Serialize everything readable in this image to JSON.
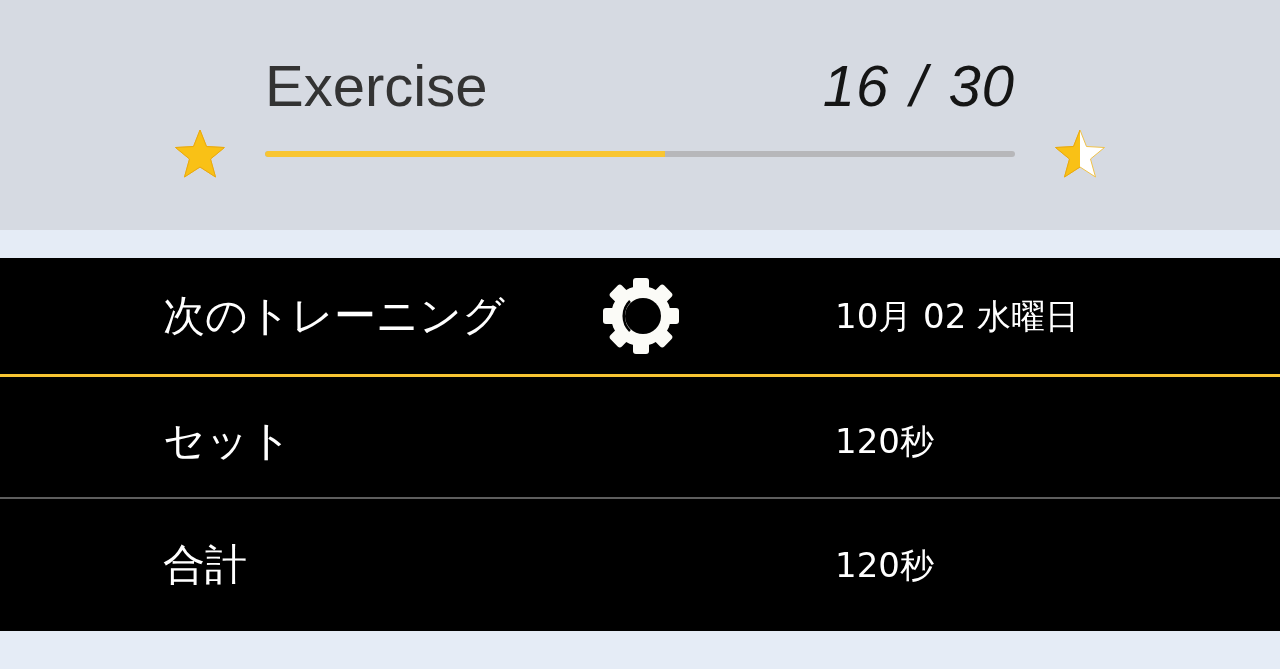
{
  "progress": {
    "title": "Exercise",
    "count": "16 / 30",
    "level": 0.533,
    "star_icons": [
      {
        "kind": "filled"
      },
      {
        "kind": "half"
      }
    ]
  },
  "rows": [
    {
      "label": "次のトレーニング",
      "value": "10月 02 水曜日",
      "kind": "with_icon",
      "selected": true
    },
    {
      "label": "セット",
      "value": "120秒",
      "kind": "plain",
      "selected": false
    },
    {
      "label": "合計",
      "value": "120秒",
      "kind": "plain",
      "selected": false
    }
  ]
}
